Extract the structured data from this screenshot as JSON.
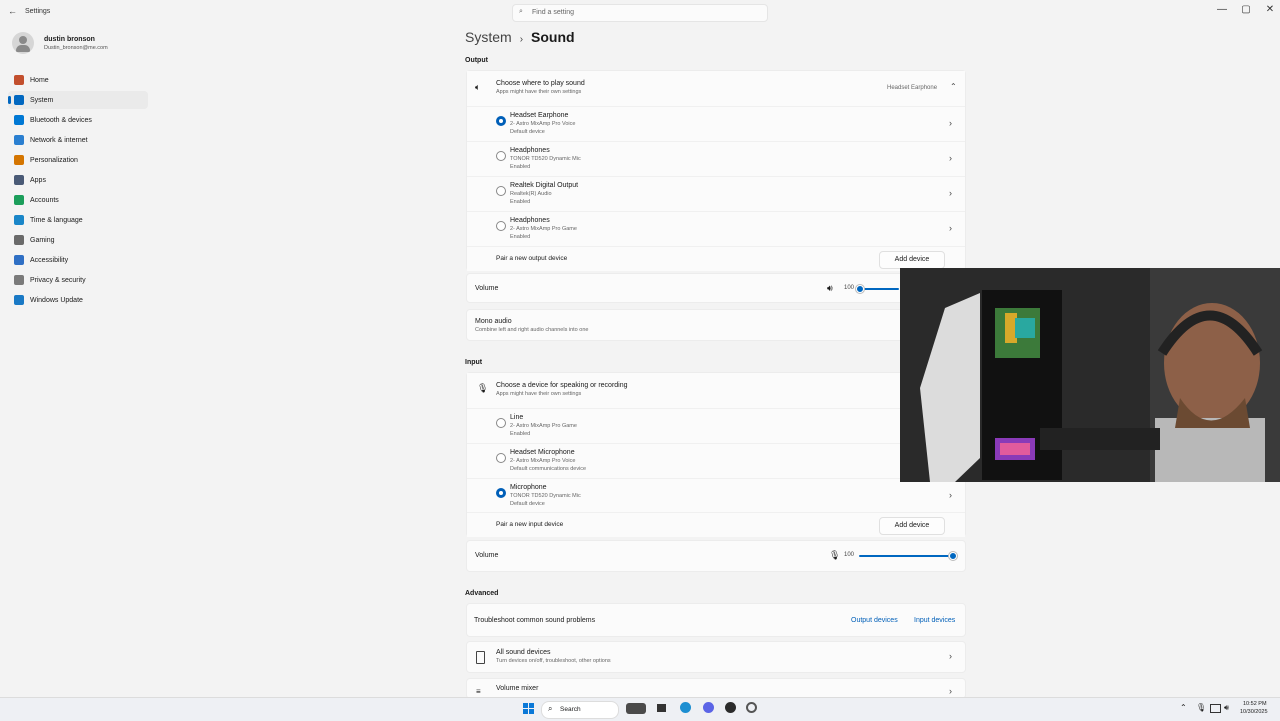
{
  "window": {
    "title": "Settings",
    "min": "—",
    "max": "▢",
    "close": "✕"
  },
  "search": {
    "placeholder": "Find a setting"
  },
  "user": {
    "name": "dustin bronson",
    "email": "Dustin_bronson@me.com"
  },
  "sidebar": {
    "items": [
      {
        "label": "Home",
        "color": "#c24f2d"
      },
      {
        "label": "System",
        "color": "#0067c0",
        "selected": true
      },
      {
        "label": "Bluetooth & devices",
        "color": "#0078d4"
      },
      {
        "label": "Network & internet",
        "color": "#2a7fd0"
      },
      {
        "label": "Personalization",
        "color": "#d47500"
      },
      {
        "label": "Apps",
        "color": "#4a5a76"
      },
      {
        "label": "Accounts",
        "color": "#1c9e5b"
      },
      {
        "label": "Time & language",
        "color": "#1a86c8"
      },
      {
        "label": "Gaming",
        "color": "#6a6a6a"
      },
      {
        "label": "Accessibility",
        "color": "#2f6fc4"
      },
      {
        "label": "Privacy & security",
        "color": "#7a7a7a"
      },
      {
        "label": "Windows Update",
        "color": "#1979c5"
      }
    ]
  },
  "breadcrumb": {
    "parent": "System",
    "sep": "›",
    "current": "Sound"
  },
  "output": {
    "section": "Output",
    "header_title": "Choose where to play sound",
    "header_sub": "Apps might have their own settings",
    "header_value": "Headset Earphone",
    "devices": [
      {
        "name": "Headset Earphone",
        "sub1": "2- Astro MixAmp Pro Voice",
        "sub2": "Default device",
        "selected": true
      },
      {
        "name": "Headphones",
        "sub1": "TONOR TD520 Dynamic Mic",
        "sub2": "Enabled",
        "selected": false
      },
      {
        "name": "Realtek Digital Output",
        "sub1": "Realtek(R) Audio",
        "sub2": "Enabled",
        "selected": false
      },
      {
        "name": "Headphones",
        "sub1": "2- Astro MixAmp Pro Game",
        "sub2": "Enabled",
        "selected": false
      }
    ],
    "pair_label": "Pair a new output device",
    "add_button": "Add device",
    "volume_label": "Volume",
    "volume_value": "100",
    "volume_level": 1.0,
    "mono_title": "Mono audio",
    "mono_sub": "Combine left and right audio channels into one"
  },
  "input": {
    "section": "Input",
    "header_title": "Choose a device for speaking or recording",
    "header_sub": "Apps might have their own settings",
    "devices": [
      {
        "name": "Line",
        "sub1": "2- Astro MixAmp Pro Game",
        "sub2": "Enabled",
        "selected": false
      },
      {
        "name": "Headset Microphone",
        "sub1": "2- Astro MixAmp Pro Voice",
        "sub2": "Default communications device",
        "selected": false
      },
      {
        "name": "Microphone",
        "sub1": "TONOR TD520 Dynamic Mic",
        "sub2": "Default device",
        "selected": true
      }
    ],
    "pair_label": "Pair a new input device",
    "add_button": "Add device",
    "volume_label": "Volume",
    "volume_value": "100",
    "volume_level": 1.0
  },
  "advanced": {
    "section": "Advanced",
    "troubleshoot": "Troubleshoot common sound problems",
    "output_link": "Output devices",
    "input_link": "Input devices",
    "all_title": "All sound devices",
    "all_sub": "Turn devices on/off, troubleshoot, other options",
    "mixer_title": "Volume mixer"
  },
  "taskbar": {
    "search": "Search",
    "time": "10:52 PM",
    "date": "10/30/2025"
  }
}
